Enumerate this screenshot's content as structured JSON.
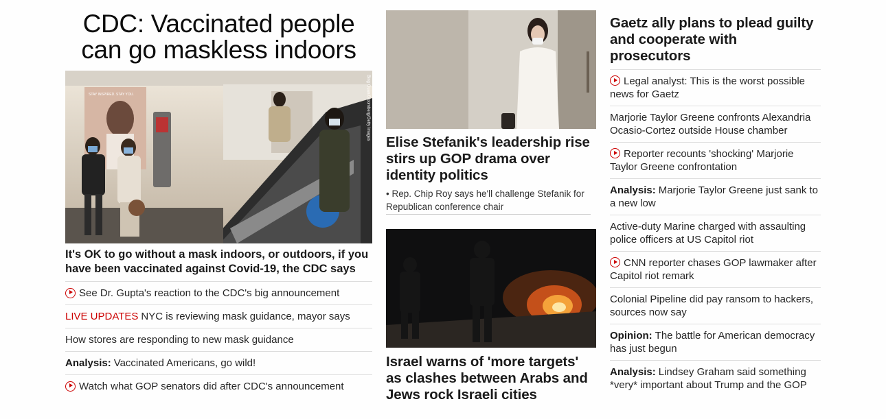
{
  "left": {
    "hero_title": "CDC: Vaccinated people can go maskless indoors",
    "photo_credit": "Bing Guan/Bloomberg/Getty Images",
    "poster_text": "STAY INSPIRED. STAY YOU.",
    "hero_caption": "It's OK to go without a mask indoors, or outdoors, if you have been vaccinated against Covid-19, the CDC says",
    "items": [
      {
        "video": true,
        "prefix": "",
        "live": "",
        "text": "See Dr. Gupta's reaction to the CDC's big announcement"
      },
      {
        "video": false,
        "prefix": "",
        "live": "LIVE UPDATES",
        "text": "NYC is reviewing mask guidance, mayor says"
      },
      {
        "video": false,
        "prefix": "",
        "live": "",
        "text": "How stores are responding to new mask guidance"
      },
      {
        "video": false,
        "prefix": "Analysis:",
        "live": "",
        "text": "Vaccinated Americans, go wild!"
      },
      {
        "video": true,
        "prefix": "",
        "live": "",
        "text": "Watch what GOP senators did after CDC's announcement"
      }
    ]
  },
  "middle": {
    "story1_headline": "Elise Stefanik's leadership rise stirs up GOP drama over identity politics",
    "story1_sub": "• Rep. Chip Roy says he'll challenge Stefanik for Republican conference chair",
    "story2_headline": "Israel warns of 'more targets' as clashes between Arabs and Jews rock Israeli cities"
  },
  "right": {
    "headline": "Gaetz ally plans to plead guilty and cooperate with prosecutors",
    "items": [
      {
        "video": true,
        "prefix": "",
        "text": "Legal analyst: This is the worst possible news for Gaetz"
      },
      {
        "video": false,
        "prefix": "",
        "text": "Marjorie Taylor Greene confronts Alexandria Ocasio-Cortez outside House chamber"
      },
      {
        "video": true,
        "prefix": "",
        "text": "Reporter recounts 'shocking' Marjorie Taylor Greene confrontation"
      },
      {
        "video": false,
        "prefix": "Analysis:",
        "text": "Marjorie Taylor Greene just sank to a new low"
      },
      {
        "video": false,
        "prefix": "",
        "text": "Active-duty Marine charged with assaulting police officers at US Capitol riot"
      },
      {
        "video": true,
        "prefix": "",
        "text": "CNN reporter chases GOP lawmaker after Capitol riot remark"
      },
      {
        "video": false,
        "prefix": "",
        "text": "Colonial Pipeline did pay ransom to hackers, sources now say"
      },
      {
        "video": false,
        "prefix": "Opinion:",
        "text": "The battle for American democracy has just begun"
      },
      {
        "video": false,
        "prefix": "Analysis:",
        "text": "Lindsey Graham said something *very* important about Trump and the GOP"
      }
    ]
  },
  "colors": {
    "accent_red": "#cc0000",
    "text": "#262626",
    "divider": "#dddddd"
  },
  "icons": {
    "video": "play-circle-icon"
  }
}
